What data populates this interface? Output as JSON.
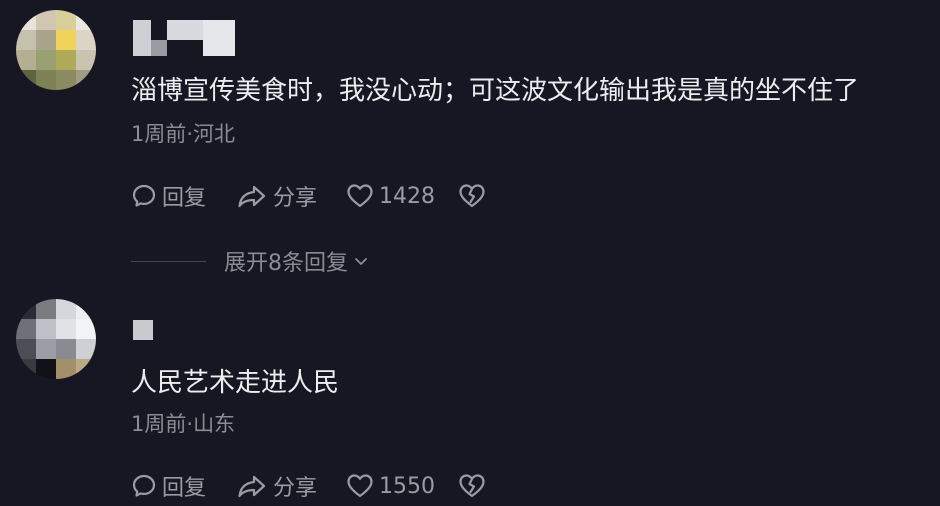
{
  "comments": [
    {
      "text": "淄博宣传美食时，我没心动；可这波文化输出我是真的坐不住了",
      "time": "1周前",
      "location": "河北",
      "reply_label": "回复",
      "share_label": "分享",
      "likes": "1428",
      "replies_expand": "展开8条回复"
    },
    {
      "text": "人民艺术走进人民",
      "time": "1周前",
      "location": "山东",
      "reply_label": "回复",
      "share_label": "分享",
      "likes": "1550"
    }
  ],
  "meta_separator": "·",
  "icons": {
    "reply": "speech-bubble-icon",
    "share": "share-arrow-icon",
    "like": "heart-outline-icon",
    "dislike": "broken-heart-icon",
    "expand": "chevron-down-icon"
  },
  "colors": {
    "background": "#161722",
    "text": "#ececee",
    "secondary_text": "#8a8b95"
  }
}
